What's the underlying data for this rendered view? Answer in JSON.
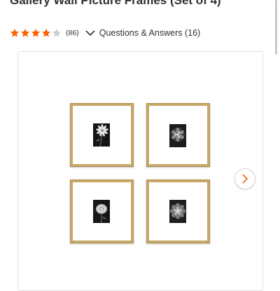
{
  "product": {
    "title": "Gallery Wall Picture Frames (Set of 4)"
  },
  "rating": {
    "stars": 4,
    "max_stars": 5,
    "review_count_label": "(86)",
    "qa_label": "Questions & Answers (16)"
  },
  "gallery": {
    "icons": {
      "next": "chevron-right-icon"
    },
    "frames": [
      {
        "subject": "daisy-flower"
      },
      {
        "subject": "succulent-rosette"
      },
      {
        "subject": "rose-flower"
      },
      {
        "subject": "succulent-rosette"
      }
    ]
  },
  "colors": {
    "accent": "#f96302",
    "star_empty": "#cccccc",
    "frame_gold": "#c9a96a",
    "text": "#333333"
  }
}
